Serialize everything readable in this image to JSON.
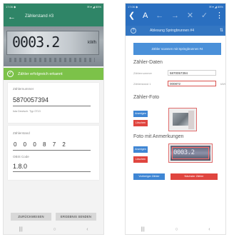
{
  "left_screen": {
    "status": {
      "time": "17:06 ◆",
      "icons": "✉ ▾ ◢ 85%"
    },
    "toolbar": {
      "title": "Zählerstand #3"
    },
    "photo": {
      "digits": "0003.2",
      "unit": "kWh"
    },
    "success": {
      "message": "Zähler erfolgreich erkannt"
    },
    "meter_card": {
      "label": "Zählernummer",
      "value": "5870057394",
      "sub": "Ista Deutsch. Typ 0713"
    },
    "reading_card": {
      "label": "Zählerstand",
      "digits": "0 0 0 8 7 2",
      "obis_label": "OBIS Code",
      "obis_value": "1.8.0"
    },
    "buttons": {
      "reject": "ZURÜCKWEISEN",
      "send": "ERGEBNIS SENDEN"
    },
    "navbar": {
      "recent": "|||",
      "home": "○",
      "back": "‹"
    }
  },
  "right_screen": {
    "status": {
      "time": "17:06 ◆",
      "icons": "✉ ▾ ◢ 85%"
    },
    "topbar": {
      "back": "❮",
      "swap": "A",
      "left": "←",
      "right": "→",
      "close": "✕",
      "ok": "✓",
      "menu": "⋮"
    },
    "subbar": {
      "help": "?",
      "title": "Ablesung Springbrunnen #4",
      "sort": "⇅"
    },
    "big_button": "Zähler scannen mit Springbrunnen #4",
    "meter_section": {
      "title": "Zähler-Daten",
      "number_label": "Zählernummer",
      "number_value": "5870057394",
      "reading_label": "Zählerstand 1",
      "reading_value": "000872",
      "unit": "kWh"
    },
    "photo_section": {
      "title": "Zähler-Foto",
      "show": "Anzeigen",
      "delete": "Löschen"
    },
    "annot_section": {
      "title": "Foto mit Anmerkungen",
      "show": "Anzeigen",
      "delete": "Löschen",
      "preview_digits": "0003.2"
    },
    "footer": {
      "prev": "Vorheriger Zähler",
      "next": "Nächster Zähler"
    },
    "navbar": {
      "recent": "|||",
      "home": "○",
      "back": "‹"
    }
  },
  "colors": {
    "left_accent": "#2f8567",
    "success": "#7cc249",
    "right_accent": "#2a6fc0",
    "delete_red": "#e0453f"
  }
}
